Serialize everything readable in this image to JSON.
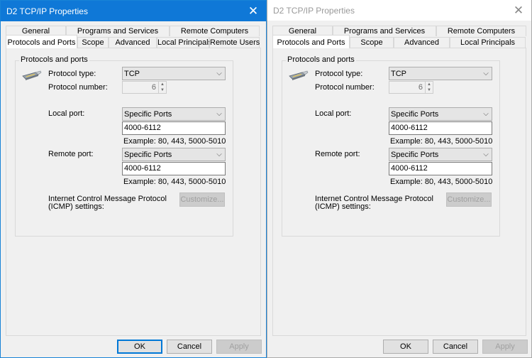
{
  "dialogs": [
    {
      "state": "active",
      "title": "D2 TCP/IP Properties",
      "tabs_row1": [
        "General",
        "Programs and Services",
        "Remote Computers"
      ],
      "tabs_row2": [
        "Protocols and Ports",
        "Scope",
        "Advanced",
        "Local Principals",
        "Remote Users"
      ],
      "selected_tab": "Protocols and Ports",
      "group_title": "Protocols and ports",
      "protocol_type_label": "Protocol type:",
      "protocol_type_value": "TCP",
      "protocol_number_label": "Protocol number:",
      "protocol_number_value": "6",
      "local_port_label": "Local port:",
      "local_port_mode": "Specific Ports",
      "local_port_value": "4000-6112",
      "local_port_example": "Example: 80, 443, 5000-5010",
      "remote_port_label": "Remote port:",
      "remote_port_mode": "Specific Ports",
      "remote_port_value": "4000-6112",
      "remote_port_example": "Example: 80, 443, 5000-5010",
      "icmp_label_line1": "Internet Control Message Protocol",
      "icmp_label_line2": "(ICMP) settings:",
      "customize_label": "Customize...",
      "ok_label": "OK",
      "cancel_label": "Cancel",
      "apply_label": "Apply"
    },
    {
      "state": "inactive",
      "title": "D2 TCP/IP Properties",
      "tabs_row1": [
        "General",
        "Programs and Services",
        "Remote Computers"
      ],
      "tabs_row2": [
        "Protocols and Ports",
        "Scope",
        "Advanced",
        "Local Principals"
      ],
      "selected_tab": "Protocols and Ports",
      "group_title": "Protocols and ports",
      "protocol_type_label": "Protocol type:",
      "protocol_type_value": "TCP",
      "protocol_number_label": "Protocol number:",
      "protocol_number_value": "6",
      "local_port_label": "Local port:",
      "local_port_mode": "Specific Ports",
      "local_port_value": "4000-6112",
      "local_port_example": "Example: 80, 443, 5000-5010",
      "remote_port_label": "Remote port:",
      "remote_port_mode": "Specific Ports",
      "remote_port_value": "4000-6112",
      "remote_port_example": "Example: 80, 443, 5000-5010",
      "icmp_label_line1": "Internet Control Message Protocol",
      "icmp_label_line2": "(ICMP) settings:",
      "customize_label": "Customize...",
      "ok_label": "OK",
      "cancel_label": "Cancel",
      "apply_label": "Apply"
    }
  ],
  "icons": {
    "close": "✕",
    "chevron": "⌵",
    "spin_up": "▲",
    "spin_down": "▼"
  },
  "colors": {
    "active_titlebar": "#0f78d7",
    "inactive_titlebar": "#ffffff",
    "dialog_bg": "#f0f0f0",
    "default_button_border": "#0078d7"
  }
}
